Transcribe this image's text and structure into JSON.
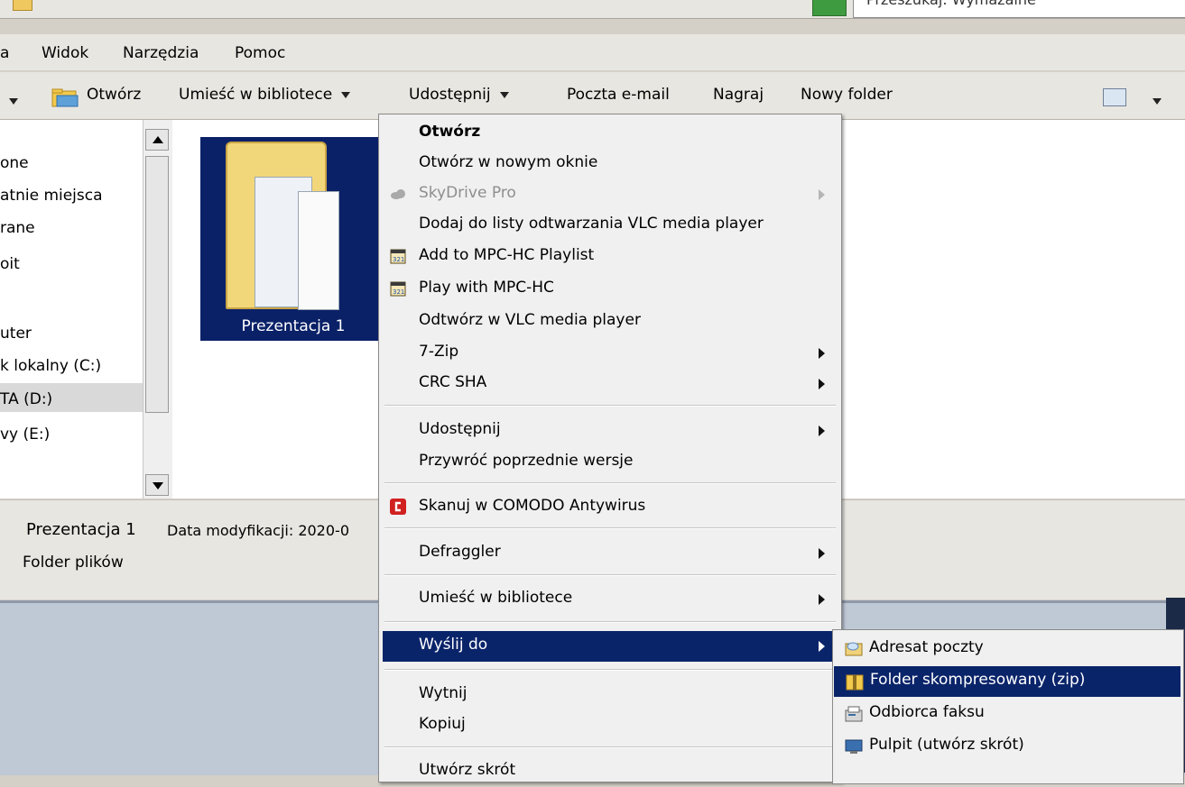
{
  "window": {
    "search_text": "Przeszukaj: Wymazalne"
  },
  "menubar": {
    "items": [
      "a",
      "Widok",
      "Narzędzia",
      "Pomoc"
    ]
  },
  "toolbar": {
    "open_label": "Otwórz",
    "library_label": "Umieść w bibliotece",
    "share_label": "Udostępnij",
    "email_label": "Poczta e-mail",
    "burn_label": "Nagraj",
    "new_folder_label": "Nowy folder"
  },
  "navpane": {
    "items": [
      "one",
      "atnie miejsca",
      "rane",
      "oit",
      "uter",
      "k lokalny (C:)",
      "TA (D:)",
      "vy (E:)"
    ]
  },
  "content": {
    "folder_name": "Prezentacja 1"
  },
  "details": {
    "name": "Prezentacja 1",
    "date_label": "Data modyfikacji: 2020-0",
    "type": "Folder plików"
  },
  "context_menu": {
    "items": [
      "Otwórz",
      "Otwórz w nowym oknie",
      "SkyDrive Pro",
      "Dodaj do listy odtwarzania VLC media player",
      "Add to MPC-HC Playlist",
      "Play with MPC-HC",
      "Odtwórz w VLC media player",
      "7-Zip",
      "CRC SHA",
      "Udostępnij",
      "Przywróć poprzednie wersje",
      "Skanuj w COMODO Antywirus",
      "Defraggler",
      "Umieść w bibliotece",
      "Wyślij do",
      "Wytnij",
      "Kopiuj",
      "Utwórz skrót"
    ]
  },
  "submenu": {
    "items": [
      "Adresat poczty",
      "Folder skompresowany (zip)",
      "Odbiorca faksu",
      "Pulpit (utwórz skrót)"
    ]
  },
  "colors": {
    "highlight": "#0a246a",
    "menu_bg": "#f0f0f0",
    "selection_tile": "#0a2168"
  }
}
